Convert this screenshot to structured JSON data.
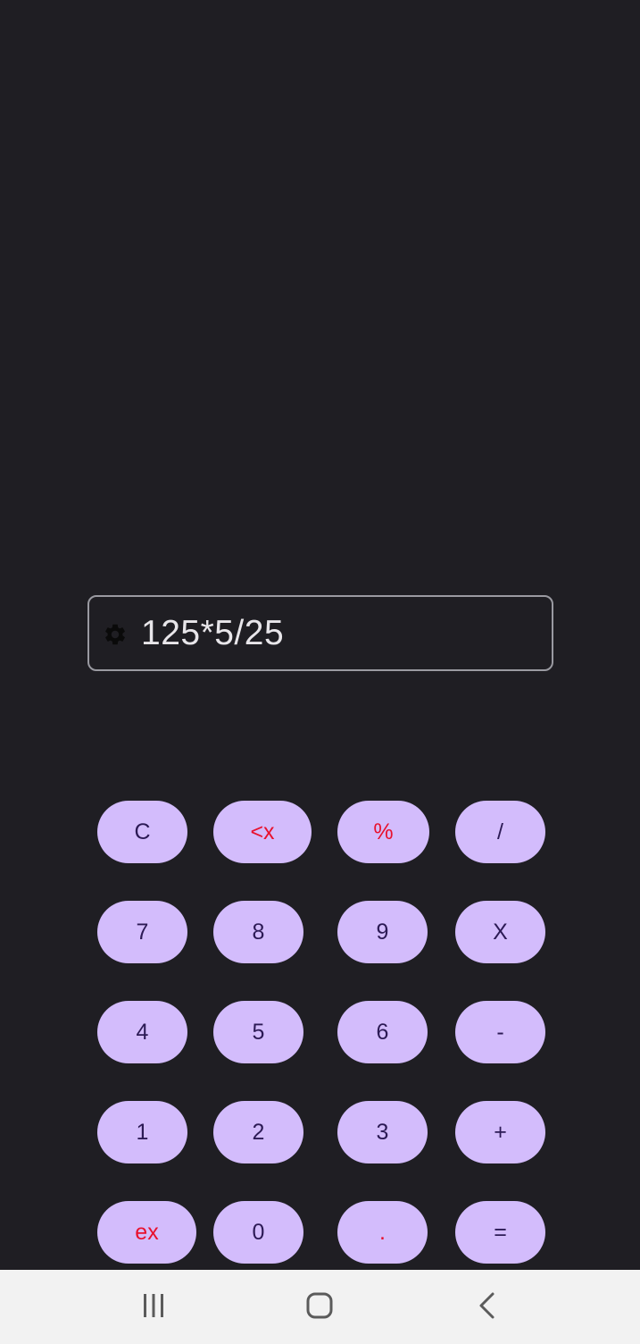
{
  "display": {
    "expression": "125*5/25",
    "settings_icon": "gear-icon"
  },
  "keypad": {
    "rows": [
      [
        {
          "label": "C",
          "name": "clear-button",
          "style": "normal"
        },
        {
          "label": "<x",
          "name": "backspace-button",
          "style": "red"
        },
        {
          "label": "%",
          "name": "percent-button",
          "style": "red"
        },
        {
          "label": "/",
          "name": "divide-button",
          "style": "normal"
        }
      ],
      [
        {
          "label": "7",
          "name": "digit-7-button",
          "style": "normal"
        },
        {
          "label": "8",
          "name": "digit-8-button",
          "style": "normal"
        },
        {
          "label": "9",
          "name": "digit-9-button",
          "style": "normal"
        },
        {
          "label": "X",
          "name": "multiply-button",
          "style": "normal"
        }
      ],
      [
        {
          "label": "4",
          "name": "digit-4-button",
          "style": "normal"
        },
        {
          "label": "5",
          "name": "digit-5-button",
          "style": "normal"
        },
        {
          "label": "6",
          "name": "digit-6-button",
          "style": "normal"
        },
        {
          "label": "-",
          "name": "subtract-button",
          "style": "normal"
        }
      ],
      [
        {
          "label": "1",
          "name": "digit-1-button",
          "style": "normal"
        },
        {
          "label": "2",
          "name": "digit-2-button",
          "style": "normal"
        },
        {
          "label": "3",
          "name": "digit-3-button",
          "style": "normal"
        },
        {
          "label": "+",
          "name": "add-button",
          "style": "normal"
        }
      ],
      [
        {
          "label": "ex",
          "name": "ex-button",
          "style": "red"
        },
        {
          "label": "0",
          "name": "digit-0-button",
          "style": "normal"
        },
        {
          "label": ".",
          "name": "decimal-point-button",
          "style": "red"
        },
        {
          "label": "=",
          "name": "equals-button",
          "style": "normal"
        }
      ]
    ]
  },
  "navigation": {
    "recents_icon": "recent-apps-icon",
    "home_icon": "home-icon",
    "back_icon": "back-icon"
  },
  "colors": {
    "background": "#1f1e23",
    "key_background": "#d3bcfc",
    "key_text": "#2c1a55",
    "key_accent_text": "#e8112d",
    "nav_background": "#f2f2f2"
  }
}
